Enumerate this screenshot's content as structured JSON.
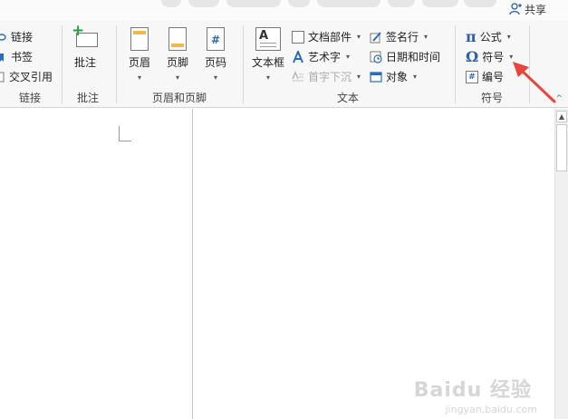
{
  "share": {
    "label": "共享"
  },
  "groups": {
    "links": {
      "label": "链接",
      "items": [
        "链接",
        "书签",
        "交叉引用"
      ]
    },
    "comments": {
      "label": "批注",
      "items": [
        "批注"
      ]
    },
    "header_footer": {
      "label": "页眉和页脚",
      "items": [
        "页眉",
        "页脚",
        "页码"
      ]
    },
    "text": {
      "label": "文本",
      "textbox": "文本框",
      "items": [
        "文档部件",
        "艺术字",
        "首字下沉",
        "签名行",
        "日期和时间",
        "对象"
      ]
    },
    "symbols": {
      "label": "符号",
      "items": [
        "公式",
        "符号",
        "编号"
      ],
      "equation_glyph": "π",
      "symbol_glyph": "Ω",
      "number_glyph": "#"
    }
  },
  "icons": {
    "equation": "pi-icon",
    "symbol": "omega-icon"
  },
  "colors": {
    "annotation_arrow": "#e8453c",
    "accent_blue": "#2b6cb8",
    "header_band": "#f2b84b",
    "add_green": "#2e9a4e"
  },
  "watermark": {
    "text": "Baidu 经验",
    "url_text": "jingyan.baidu.com"
  }
}
